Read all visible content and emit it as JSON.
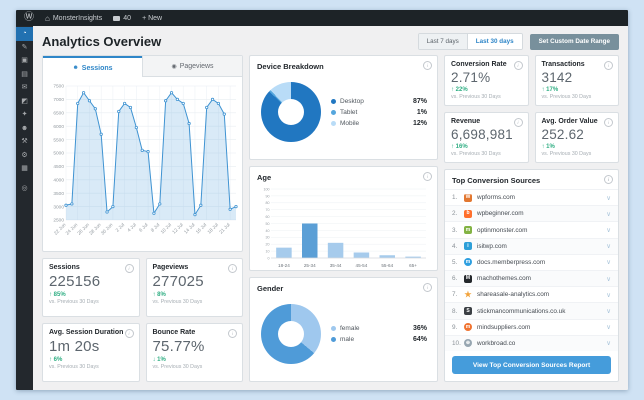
{
  "admin_bar": {
    "wp_logo_glyph": "Ⓦ",
    "site_name": "MonsterInsights",
    "comments_count": "40",
    "new_label": "+ New"
  },
  "sidebar": {
    "items": [
      {
        "name": "menu-monsterinsights-dashboard",
        "glyph": "◔",
        "active": true
      },
      {
        "name": "menu-posts",
        "glyph": "✎",
        "active": false
      },
      {
        "name": "menu-media",
        "glyph": "▣",
        "active": false
      },
      {
        "name": "menu-pages",
        "glyph": "▤",
        "active": false
      },
      {
        "name": "menu-comments",
        "glyph": "✉",
        "active": false
      },
      {
        "name": "menu-appearance",
        "glyph": "◩",
        "active": false
      },
      {
        "name": "menu-plugins",
        "glyph": "✦",
        "active": false
      },
      {
        "name": "menu-users",
        "glyph": "☻",
        "active": false
      },
      {
        "name": "menu-tools",
        "glyph": "⚒",
        "active": false
      },
      {
        "name": "menu-settings",
        "glyph": "⚙",
        "active": false
      },
      {
        "name": "menu-analytics",
        "glyph": "▦",
        "active": false
      },
      {
        "name": "menu-collapse",
        "glyph": "◎",
        "active": false
      }
    ]
  },
  "header": {
    "title": "Analytics Overview",
    "range_buttons": [
      {
        "label": "Last 7 days",
        "active": false
      },
      {
        "label": "Last 30 days",
        "active": true
      }
    ],
    "custom_range_label": "Set Custom Date Range"
  },
  "tabs": [
    {
      "label": "Sessions",
      "icon": "person-icon",
      "glyph": "☻",
      "active": true
    },
    {
      "label": "Pageviews",
      "icon": "eye-icon",
      "glyph": "◉",
      "active": false
    }
  ],
  "labels": {
    "vs_previous": "vs. Previous 30 Days"
  },
  "stats_left": [
    {
      "title": "Sessions",
      "value": "225156",
      "change": "↑ 85%"
    },
    {
      "title": "Pageviews",
      "value": "277025",
      "change": "↑ 8%"
    },
    {
      "title": "Avg. Session Duration",
      "value": "1m 20s",
      "change": "↑ 6%"
    },
    {
      "title": "Bounce Rate",
      "value": "75.77%",
      "change": "↓ 1%"
    }
  ],
  "stats_right": [
    {
      "title": "Conversion Rate",
      "value": "2.71%",
      "change": "↑ 22%"
    },
    {
      "title": "Transactions",
      "value": "3142",
      "change": "↑ 17%"
    },
    {
      "title": "Revenue",
      "value": "6,698,981",
      "change": "↑ 16%"
    },
    {
      "title": "Avg. Order Value",
      "value": "252.62",
      "change": "↑ 1%"
    }
  ],
  "top_sources": {
    "title": "Top Conversion Sources",
    "button_label": "View Top Conversion Sources Report",
    "items": [
      {
        "rank": "1.",
        "domain": "wpforms.com",
        "icon_bg": "#e27730",
        "icon_glyph": "W",
        "icon_shape": "square"
      },
      {
        "rank": "2.",
        "domain": "wpbeginner.com",
        "icon_bg": "#ff6f2c",
        "icon_glyph": "b",
        "icon_shape": "square"
      },
      {
        "rank": "3.",
        "domain": "optinmonster.com",
        "icon_bg": "#83b344",
        "icon_glyph": "m",
        "icon_shape": "square"
      },
      {
        "rank": "4.",
        "domain": "isitwp.com",
        "icon_bg": "#2d9fd8",
        "icon_glyph": "i",
        "icon_shape": "square"
      },
      {
        "rank": "5.",
        "domain": "docs.memberpress.com",
        "icon_bg": "#2e9fe0",
        "icon_glyph": "m",
        "icon_shape": "circle"
      },
      {
        "rank": "6.",
        "domain": "machothemes.com",
        "icon_bg": "#24282c",
        "icon_glyph": "M",
        "icon_shape": "square"
      },
      {
        "rank": "7.",
        "domain": "shareasale-analytics.com",
        "icon_bg": "none",
        "icon_glyph": "★",
        "icon_shape": "star",
        "icon_fg": "#f2a33c"
      },
      {
        "rank": "8.",
        "domain": "stickmancommunications.co.uk",
        "icon_bg": "#3b3f44",
        "icon_glyph": "S",
        "icon_shape": "square"
      },
      {
        "rank": "9.",
        "domain": "mindsuppliers.com",
        "icon_bg": "#f07330",
        "icon_glyph": "m",
        "icon_shape": "circle"
      },
      {
        "rank": "10.",
        "domain": "workbroad.co",
        "icon_bg": "#97a6b1",
        "icon_glyph": "⊕",
        "icon_shape": "circle"
      }
    ]
  },
  "colors": {
    "accent_blue": "#2e86c8",
    "positive_green": "#2fae83",
    "admin_bar_bg": "#1d2327",
    "sidebar_bg": "#23282d",
    "active_menu_bg": "#2271b1",
    "report_button_blue": "#459cdb",
    "custom_range_button_bg": "#78909c",
    "chart_line_blue": "#3f93d2"
  },
  "chart_data": [
    {
      "id": "sessions",
      "type": "area",
      "title": "Sessions",
      "x_labels": [
        "22 Jun",
        "24 Jun",
        "26 Jun",
        "28 Jun",
        "30 Jun",
        "2 Jul",
        "4 Jul",
        "6 Jul",
        "8 Jul",
        "10 Jul",
        "12 Jul",
        "14 Jul",
        "16 Jul",
        "18 Jul",
        "21 Jul"
      ],
      "label_indices": [
        0,
        2,
        4,
        6,
        8,
        10,
        12,
        14,
        16,
        18,
        20,
        22,
        24,
        26,
        28
      ],
      "values": [
        3050,
        3100,
        6850,
        7250,
        6950,
        6650,
        5700,
        2800,
        3000,
        6550,
        6850,
        6700,
        5950,
        5100,
        5050,
        2750,
        3100,
        6950,
        7250,
        7000,
        6850,
        6100,
        2700,
        3050,
        6700,
        7000,
        6850,
        6450,
        2900,
        3000
      ],
      "ylim": [
        2500,
        7500
      ],
      "ytick_step": 500,
      "grid": true,
      "line_color": "#3f93d2",
      "fill_color": "rgba(119,178,227,0.28)"
    },
    {
      "id": "device",
      "type": "donut",
      "title": "Device Breakdown",
      "value_suffix": "%",
      "segments": [
        {
          "label": "Desktop",
          "value": 87,
          "color": "#2177c1"
        },
        {
          "label": "Tablet",
          "value": 1,
          "color": "#55a6dd"
        },
        {
          "label": "Mobile",
          "value": 12,
          "color": "#b9dcf7"
        }
      ]
    },
    {
      "id": "age",
      "type": "bar",
      "title": "Age",
      "categories": [
        "18-24",
        "25-34",
        "35-44",
        "45-54",
        "55-64",
        "65+"
      ],
      "values": [
        15,
        50,
        22,
        8,
        4,
        2
      ],
      "ylim": [
        0,
        100
      ],
      "ytick_step": 10,
      "grid": true,
      "bar_color": "#a6cbec",
      "highlight_color": "#5b9fd6",
      "highlight_index": 1
    },
    {
      "id": "gender",
      "type": "donut",
      "title": "Gender",
      "value_suffix": "%",
      "segments": [
        {
          "label": "female",
          "value": 36,
          "color": "#9fc8ee"
        },
        {
          "label": "male",
          "value": 64,
          "color": "#4f9bd8"
        }
      ]
    }
  ]
}
